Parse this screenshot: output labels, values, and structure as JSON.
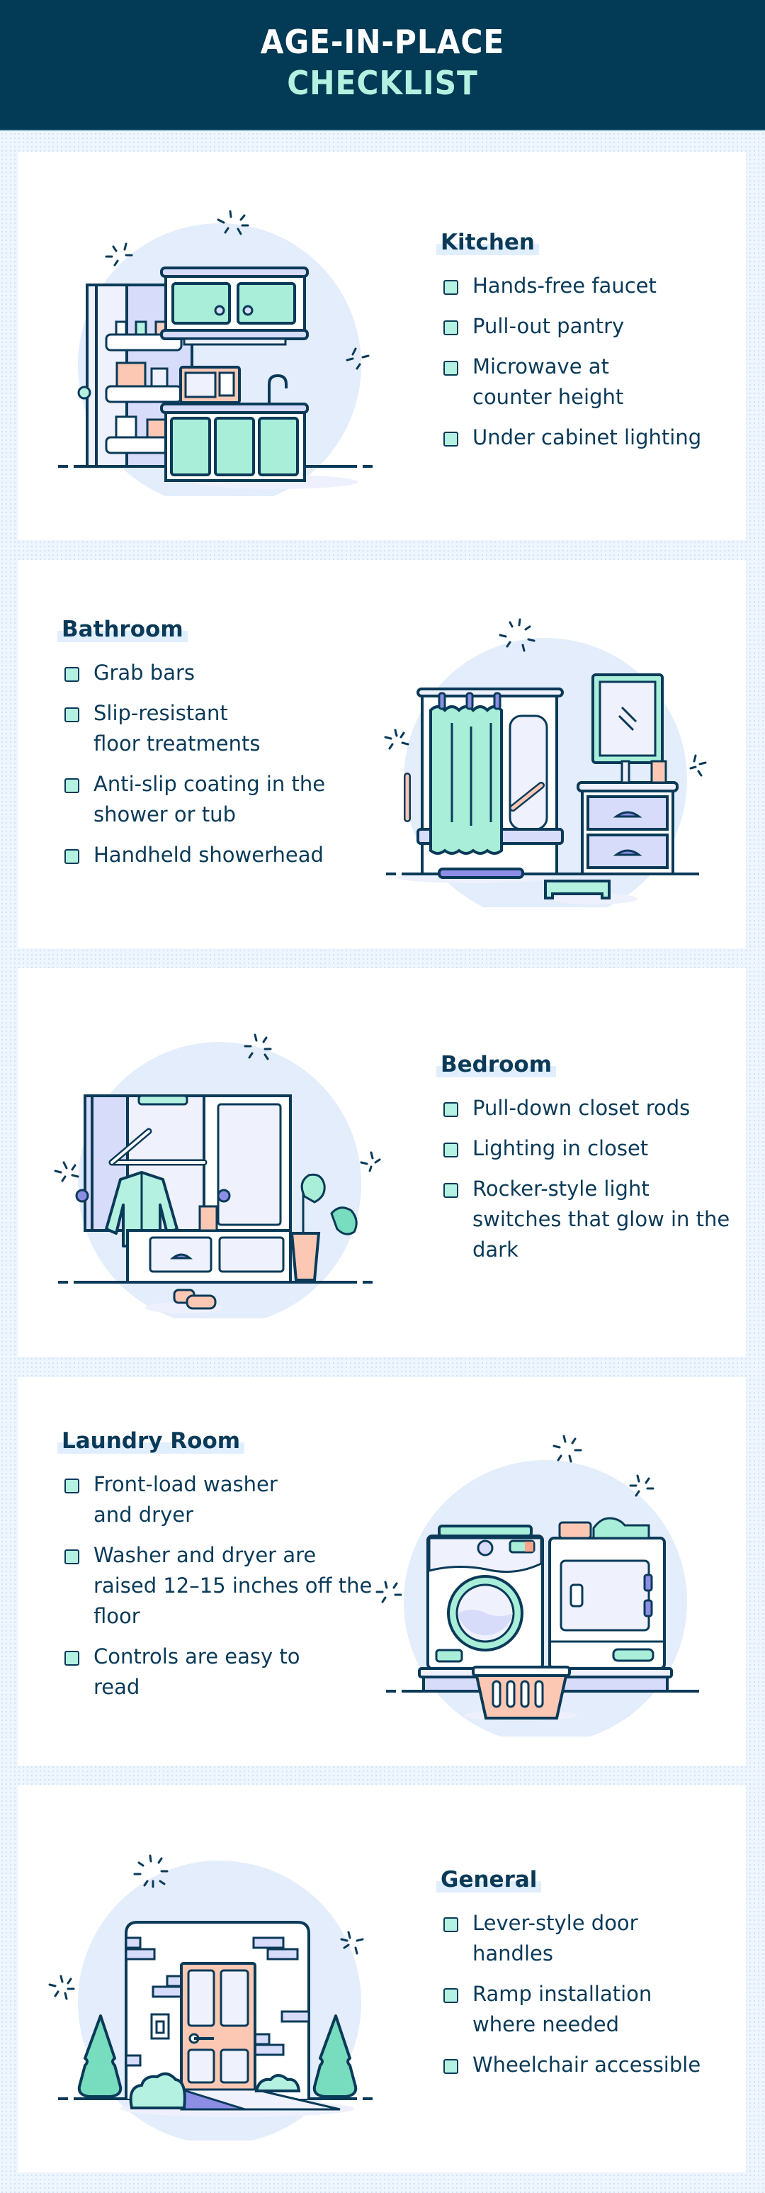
{
  "header": {
    "title_line1": "AGE-IN-PLACE",
    "title_line2": "CHECKLIST"
  },
  "colors": {
    "header_bg": "#033a55",
    "title_white": "#ffffff",
    "title_mint": "#b4f1e0",
    "text": "#0a3a58",
    "checkbox_fill": "#b4f1e0",
    "page_bg": "#eef5fe",
    "highlight": "#e1eefd"
  },
  "sections": [
    {
      "title": "Kitchen",
      "illustration": "kitchen-illustration",
      "items": [
        "Hands-free faucet",
        "Pull-out pantry",
        "Microwave at counter height",
        "Under cabinet lighting"
      ]
    },
    {
      "title": "Bathroom",
      "illustration": "bathroom-illustration",
      "items": [
        "Grab bars",
        "Slip-resistant floor treatments",
        "Anti-slip coating in the shower or tub",
        "Handheld showerhead"
      ]
    },
    {
      "title": "Bedroom",
      "illustration": "bedroom-closet-illustration",
      "items": [
        "Pull-down closet rods",
        "Lighting in closet",
        "Rocker-style light switches that glow in the dark"
      ]
    },
    {
      "title": "Laundry Room",
      "illustration": "washer-dryer-illustration",
      "items": [
        "Front-load washer and dryer",
        "Washer and dryer are raised 12–15 inches off the floor",
        "Controls are easy to read"
      ]
    },
    {
      "title": "General",
      "illustration": "house-entrance-illustration",
      "items": [
        "Lever-style door handles",
        "Ramp installation where needed",
        "Wheelchair accessible"
      ]
    }
  ]
}
